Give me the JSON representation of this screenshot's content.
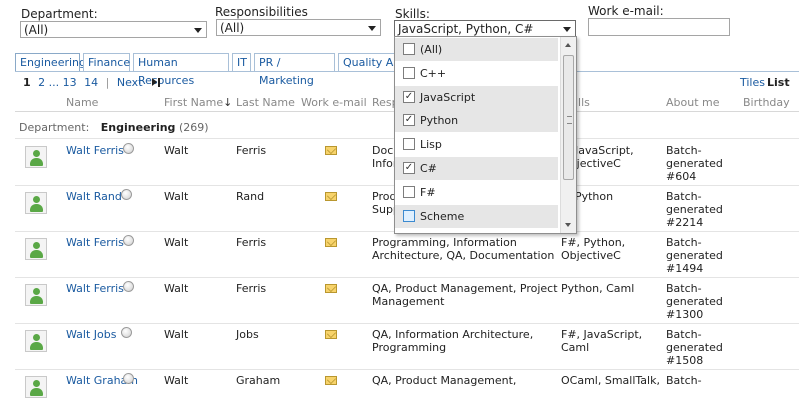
{
  "filters": {
    "department": {
      "label": "Department:",
      "value": "(All)"
    },
    "responsibilities": {
      "label": "Responsibilities",
      "value": "(All)"
    },
    "skills": {
      "label": "Skills:",
      "value": "JavaScript, Python, C#"
    },
    "work_email": {
      "label": "Work e-mail:",
      "value": ""
    }
  },
  "tabs": [
    {
      "label": "Engineering",
      "active": true
    },
    {
      "label": "Finance"
    },
    {
      "label": "Human Resources"
    },
    {
      "label": "IT"
    },
    {
      "label": "PR / Marketing"
    },
    {
      "label": "Quality Ass"
    }
  ],
  "pager": {
    "current": "1",
    "p2": "2",
    "ellipsis": "...",
    "p13": "13",
    "p14": "14",
    "sep": "|",
    "next": "Next",
    "last_icon": "last-page-icon"
  },
  "view_modes": {
    "tiles": "Tiles",
    "list": "List"
  },
  "columns": {
    "name": "Name",
    "first_name": "First Name",
    "sort_arrow": "↓",
    "last_name": "Last Name",
    "work_email": "Work e-mail",
    "responsibilities": "Resp",
    "skills": "ills",
    "about": "About me",
    "birthday": "Birthday"
  },
  "group": {
    "label": "Department:",
    "name": "Engineering",
    "count": "(269)"
  },
  "skills_dropdown": {
    "options": [
      {
        "label": "(All)",
        "checked": false,
        "shaded": true
      },
      {
        "label": "C++",
        "checked": false,
        "shaded": false
      },
      {
        "label": "JavaScript",
        "checked": true,
        "shaded": true
      },
      {
        "label": "Python",
        "checked": true,
        "shaded": true
      },
      {
        "label": "Lisp",
        "checked": false,
        "shaded": false
      },
      {
        "label": "C#",
        "checked": true,
        "shaded": true
      },
      {
        "label": "F#",
        "checked": false,
        "shaded": false
      },
      {
        "label": "Scheme",
        "checked": false,
        "shaded": true,
        "highlight": true
      }
    ]
  },
  "rows": [
    {
      "name": "Walt Ferris",
      "first": "Walt",
      "last": "Ferris",
      "resp": [
        "Docu",
        "Inforr"
      ],
      "skills": [
        "p, JavaScript,",
        "ObjectiveC"
      ],
      "about": [
        "Batch-",
        "generated",
        "#604"
      ]
    },
    {
      "name": "Walt Rand",
      "first": "Walt",
      "last": "Rand",
      "resp": [
        "Prod",
        "Supp"
      ],
      "skills": [
        "p, Python"
      ],
      "about": [
        "Batch-",
        "generated",
        "#2214"
      ]
    },
    {
      "name": "Walt Ferris",
      "first": "Walt",
      "last": "Ferris",
      "resp": [
        "Programming, Information",
        "Architecture, QA, Documentation"
      ],
      "skills": [
        "F#, Python,",
        "ObjectiveC"
      ],
      "about": [
        "Batch-",
        "generated",
        "#1494"
      ]
    },
    {
      "name": "Walt Ferris",
      "first": "Walt",
      "last": "Ferris",
      "resp": [
        "QA, Product Management, Project",
        "Management"
      ],
      "skills": [
        "Python, Caml"
      ],
      "about": [
        "Batch-",
        "generated",
        "#1300"
      ]
    },
    {
      "name": "Walt Jobs",
      "first": "Walt",
      "last": "Jobs",
      "resp": [
        "QA, Information Architecture,",
        "Programming"
      ],
      "skills": [
        "F#, JavaScript,",
        "Caml"
      ],
      "about": [
        "Batch-",
        "generated",
        "#1508"
      ]
    },
    {
      "name": "Walt Graham",
      "first": "Walt",
      "last": "Graham",
      "resp": [
        "QA, Product Management,"
      ],
      "skills": [
        "OCaml, SmallTalk,"
      ],
      "about": [
        "Batch-"
      ]
    }
  ]
}
